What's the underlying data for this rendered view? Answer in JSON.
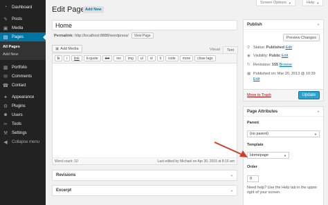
{
  "sidebar": {
    "items": [
      {
        "label": "Dashboard",
        "icon": "gauge-icon",
        "glyph": "◔"
      },
      {
        "label": "Posts",
        "icon": "pin-icon",
        "glyph": "✎"
      },
      {
        "label": "Media",
        "icon": "media-icon",
        "glyph": "▣"
      },
      {
        "label": "Pages",
        "icon": "pages-icon",
        "glyph": "▤"
      }
    ],
    "pages_sub": [
      {
        "label": "All Pages"
      },
      {
        "label": "Add New"
      }
    ],
    "items2": [
      {
        "label": "Portfolio",
        "icon": "portfolio-icon",
        "glyph": "▦"
      },
      {
        "label": "Comments",
        "icon": "comments-icon",
        "glyph": "✉"
      },
      {
        "label": "Contact",
        "icon": "contact-icon",
        "glyph": "☎"
      }
    ],
    "items3": [
      {
        "label": "Appearance",
        "icon": "appearance-icon",
        "glyph": "✦"
      },
      {
        "label": "Plugins",
        "icon": "plugins-icon",
        "glyph": "⚙"
      },
      {
        "label": "Users",
        "icon": "users-icon",
        "glyph": "☻"
      },
      {
        "label": "Tools",
        "icon": "tools-icon",
        "glyph": "✂"
      },
      {
        "label": "Settings",
        "icon": "settings-icon",
        "glyph": "⚒"
      },
      {
        "label": "Collapse menu",
        "icon": "collapse-icon",
        "glyph": "◀"
      }
    ]
  },
  "top": {
    "screen_options": "Screen Options",
    "help": "Help"
  },
  "header": {
    "title": "Edit Page",
    "add_new": "Add New"
  },
  "post": {
    "title": "Home",
    "permalink_label": "Permalink:",
    "permalink_url": "http://localhost:8888/wordpress/",
    "view_page": "View Page"
  },
  "editor": {
    "add_media": "Add Media",
    "tab_visual": "Visual",
    "tab_text": "Text",
    "buttons": [
      "b",
      "i",
      "link",
      "b-quote",
      "del",
      "ins",
      "img",
      "ul",
      "ol",
      "li",
      "code",
      "more",
      "close tags"
    ],
    "word_count": "Word count: 10",
    "last_edited": "Last edited by Michael on Apr 30, 2015 at 8:16 am"
  },
  "postboxes": {
    "revisions": "Revisions",
    "excerpt": "Excerpt"
  },
  "publish": {
    "title": "Publish",
    "preview": "Preview Changes",
    "status_label": "Status:",
    "status_value": "Published",
    "visibility_label": "Visibility:",
    "visibility_value": "Public",
    "revisions_label": "Revisions:",
    "revisions_value": "155",
    "browse": "Browse",
    "published_on": "Published on: Mar 20, 2013 @ 10:39",
    "edit": "Edit",
    "move_to_trash": "Move to Trash",
    "update": "Update"
  },
  "page_attributes": {
    "title": "Page Attributes",
    "parent_label": "Parent",
    "parent_value": "(no parent)",
    "template_label": "Template",
    "template_value": "Homepage",
    "order_label": "Order",
    "order_value": "0",
    "help_text": "Need help? Use the Help tab in the upper right of your screen."
  },
  "colors": {
    "accent": "#0074a2",
    "sidebar": "#222222",
    "update_button": "#2ea2cc",
    "arrow": "#d23c2a"
  }
}
